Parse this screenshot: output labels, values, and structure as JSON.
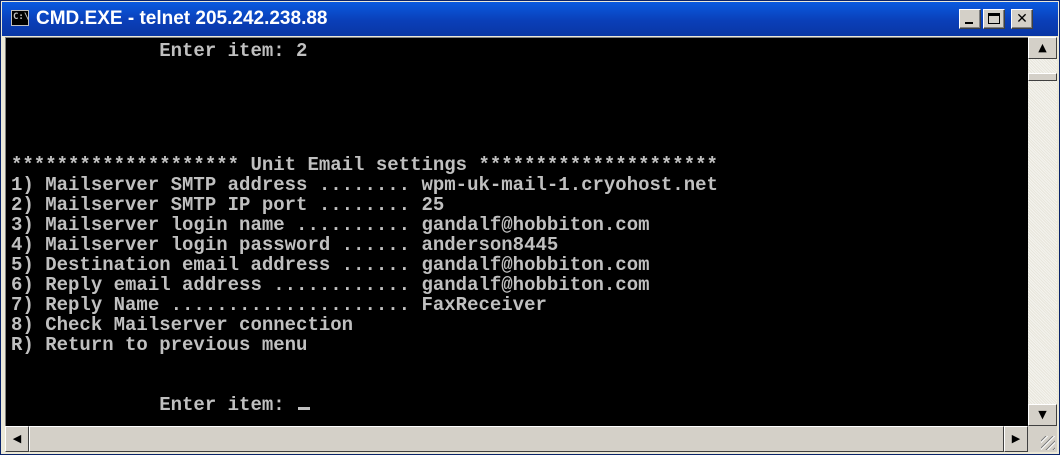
{
  "window": {
    "title": "CMD.EXE - telnet 205.242.238.88",
    "icon_text": "C:\\"
  },
  "console": {
    "lines": [
      "             Enter item: 2",
      "",
      "",
      "******************** Unit Email settings *********************",
      "1) Mailserver SMTP address ........ wpm-uk-mail-1.cryohost.net",
      "2) Mailserver SMTP IP port ........ 25",
      "3) Mailserver login name .......... gandalf@hobbiton.com",
      "4) Mailserver login password ...... anderson8445",
      "5) Destination email address ...... gandalf@hobbiton.com",
      "6) Reply email address ............ gandalf@hobbiton.com",
      "7) Reply Name ..................... FaxReceiver",
      "8) Check Mailserver connection",
      "R) Return to previous menu",
      "",
      "             Enter item: "
    ]
  },
  "icons": {
    "app": "console-icon",
    "minimize": "minimize-icon",
    "maximize": "maximize-icon",
    "close": "close-icon",
    "scroll_up": "arrow-up-icon",
    "scroll_down": "arrow-down-icon",
    "scroll_left": "arrow-left-icon",
    "scroll_right": "arrow-right-icon"
  },
  "colors": {
    "titlebar": "#0a4fd0",
    "console_bg": "#000000",
    "console_fg": "#c0c0c0"
  }
}
